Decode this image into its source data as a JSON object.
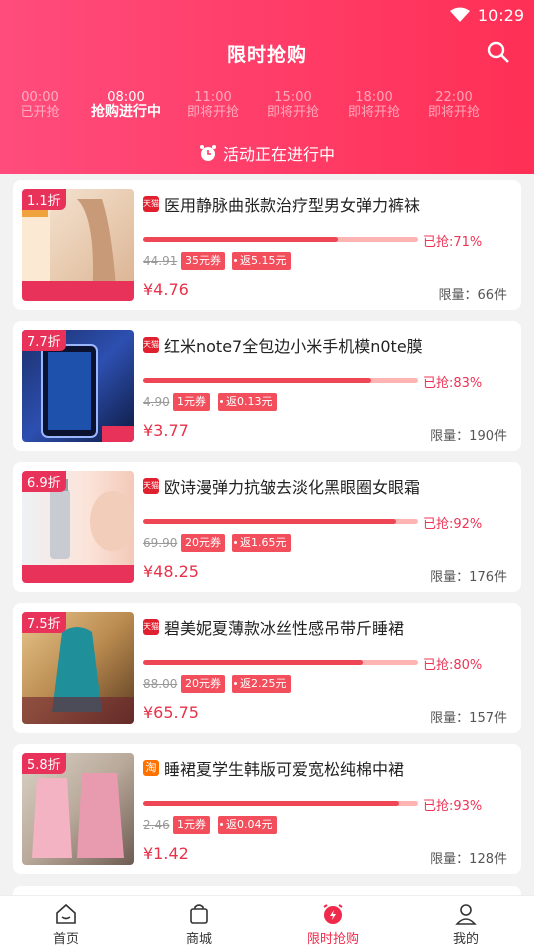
{
  "status": {
    "time": "10:29"
  },
  "header": {
    "title": "限时抢购"
  },
  "slots": [
    {
      "time": "00:00",
      "status": "已开抢"
    },
    {
      "time": "08:00",
      "status": "抢购进行中"
    },
    {
      "time": "11:00",
      "status": "即将开抢"
    },
    {
      "time": "15:00",
      "status": "即将开抢"
    },
    {
      "time": "18:00",
      "status": "即将开抢"
    },
    {
      "time": "22:00",
      "status": "即将开抢"
    }
  ],
  "active_slot_index": 1,
  "activity_text": "活动正在进行中",
  "products": [
    {
      "discount": "1.1折",
      "store": "天猫",
      "name": "医用静脉曲张款治疗型男女弹力裤袜",
      "sold_text": "已抢:71%",
      "sold_fraction": 0.71,
      "orig_price": "44.91",
      "coupon": "35元券",
      "rebate": "返5.15元",
      "price": "¥4.76",
      "limit": "限量：66件"
    },
    {
      "discount": "7.7折",
      "store": "天猫",
      "name": "红米note7全包边小米手机模n0te膜",
      "sold_text": "已抢:83%",
      "sold_fraction": 0.83,
      "orig_price": "4.90",
      "coupon": "1元券",
      "rebate": "返0.13元",
      "price": "¥3.77",
      "limit": "限量：190件"
    },
    {
      "discount": "6.9折",
      "store": "天猫",
      "name": "欧诗漫弹力抗皱去淡化黑眼圈女眼霜",
      "sold_text": "已抢:92%",
      "sold_fraction": 0.92,
      "orig_price": "69.90",
      "coupon": "20元券",
      "rebate": "返1.65元",
      "price": "¥48.25",
      "limit": "限量：176件"
    },
    {
      "discount": "7.5折",
      "store": "天猫",
      "name": "碧美妮夏薄款冰丝性感吊带斤睡裙",
      "sold_text": "已抢:80%",
      "sold_fraction": 0.8,
      "orig_price": "88.00",
      "coupon": "20元券",
      "rebate": "返2.25元",
      "price": "¥65.75",
      "limit": "限量：157件"
    },
    {
      "discount": "5.8折",
      "store": "淘",
      "name": "睡裙夏学生韩版可爱宽松纯棉中裙",
      "sold_text": "已抢:93%",
      "sold_fraction": 0.93,
      "orig_price": "2.46",
      "coupon": "1元券",
      "rebate": "返0.04元",
      "price": "¥1.42",
      "limit": "限量：128件"
    }
  ],
  "tabs": [
    {
      "label": "首页",
      "icon": "home-icon"
    },
    {
      "label": "商城",
      "icon": "shopping-bag-icon"
    },
    {
      "label": "限时抢购",
      "icon": "alarm-clock-icon"
    },
    {
      "label": "我的",
      "icon": "user-icon"
    }
  ],
  "colors": {
    "header_start": "#ff4c7c",
    "header_end": "#ff2f55",
    "accent": "#f02a4a"
  }
}
